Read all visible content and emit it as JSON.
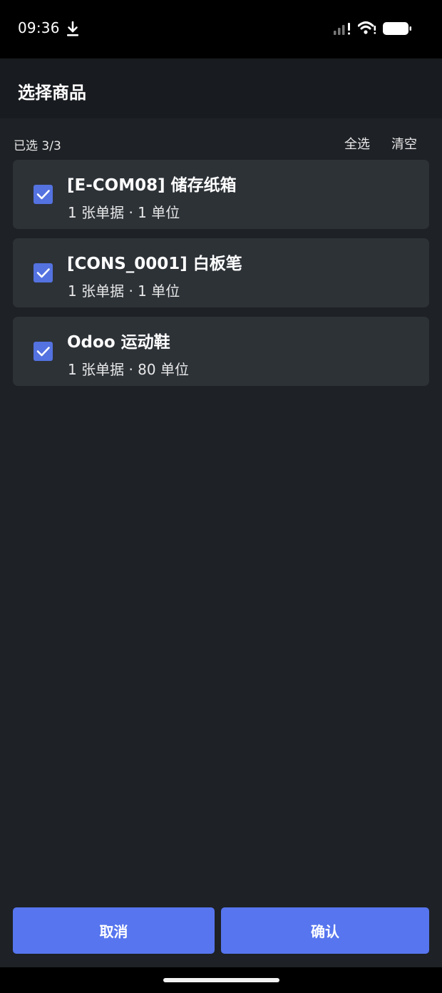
{
  "status_bar": {
    "time": "09:36",
    "icons": [
      "download-icon",
      "signal-icon",
      "wifi-icon",
      "battery-icon"
    ]
  },
  "header": {
    "title": "选择商品"
  },
  "selection": {
    "count_label": "已选 3/3",
    "select_all_label": "全选",
    "clear_label": "清空"
  },
  "products": [
    {
      "name": "[E-COM08] 储存纸箱",
      "meta": "1 张单据 · 1 单位",
      "checked": true
    },
    {
      "name": "[CONS_0001] 白板笔",
      "meta": "1 张单据 · 1 单位",
      "checked": true
    },
    {
      "name": "Odoo 运动鞋",
      "meta": "1 张单据 · 80 单位",
      "checked": true
    }
  ],
  "footer": {
    "cancel_label": "取消",
    "confirm_label": "确认"
  },
  "colors": {
    "accent": "#5675ee",
    "card_background": "#2d3237",
    "page_background": "#1e2125",
    "header_background": "#181b1f"
  }
}
